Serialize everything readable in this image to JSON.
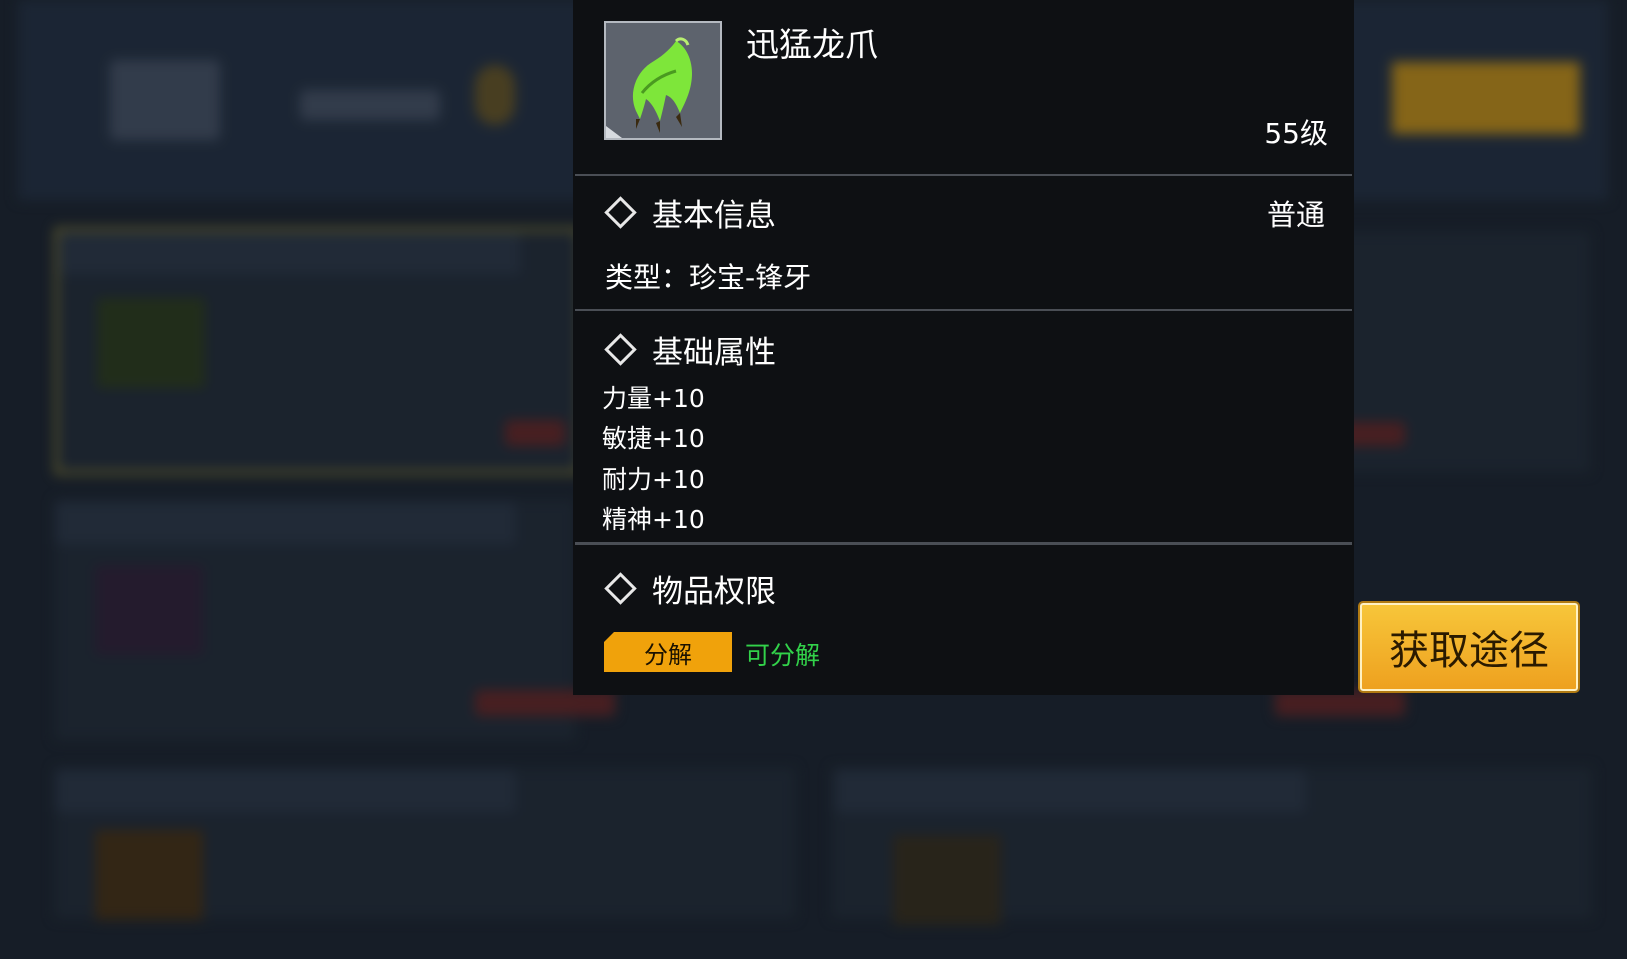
{
  "item": {
    "name": "迅猛龙爪",
    "level": "55级",
    "icon": "green-dragon-claw-icon"
  },
  "basic_info": {
    "title": "基本信息",
    "rarity": "普通",
    "type_line": "类型：珍宝-锋牙"
  },
  "base_attributes": {
    "title": "基础属性",
    "stats": [
      "力量+10",
      "敏捷+10",
      "耐力+10",
      "精神+10"
    ]
  },
  "permissions": {
    "title": "物品权限",
    "tag_label": "分解",
    "tag_state": "可分解"
  },
  "acquire_button": {
    "label": "获取途径"
  },
  "colors": {
    "panel_bg": "#0e1013",
    "accent_orange": "#f0a20b",
    "state_green": "#32d24a",
    "button_gold": "#f2b02a"
  }
}
